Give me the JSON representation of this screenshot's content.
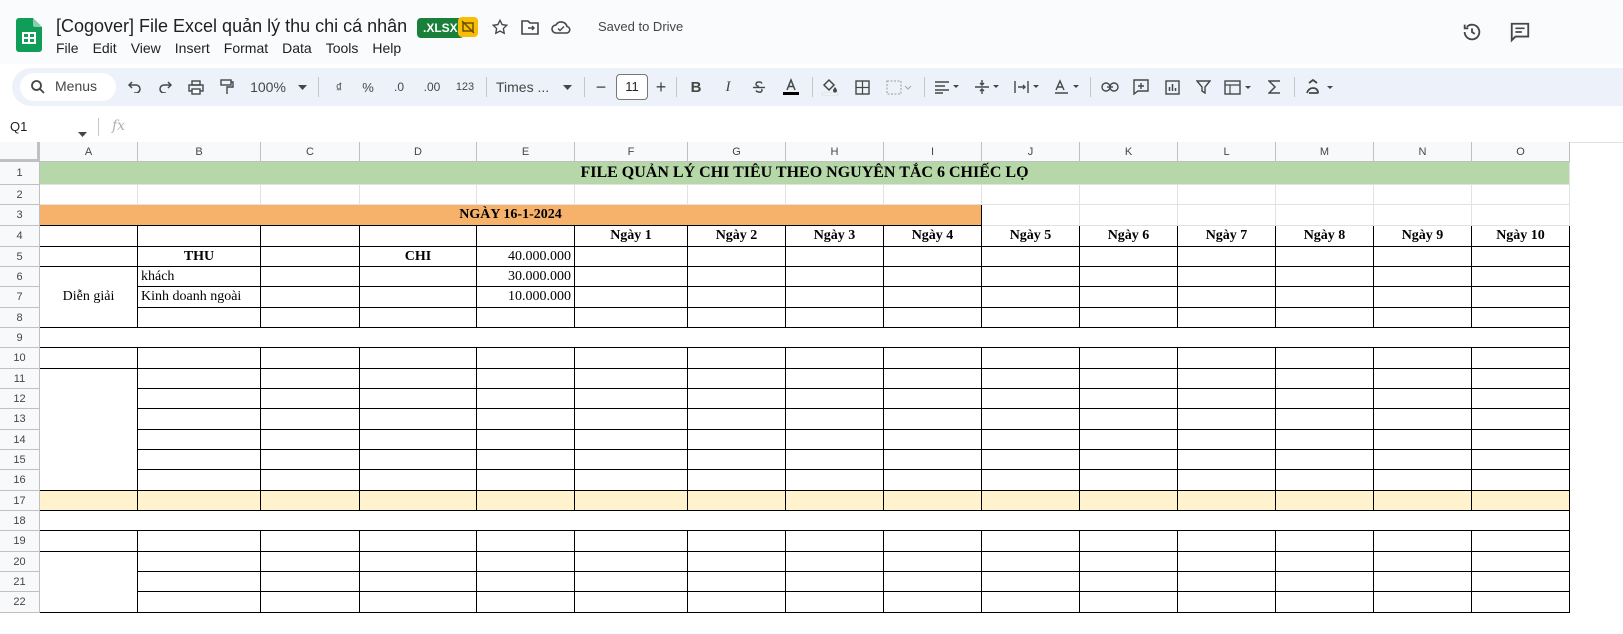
{
  "header": {
    "doc_title": "[Cogover] File Excel quản lý thu chi cá nhân",
    "file_badge": ".XLSX",
    "saved_status": "Saved to Drive",
    "icons": [
      "sheets-logo-icon",
      "no-edit-icon",
      "star-icon",
      "move-folder-icon",
      "cloud-saved-icon",
      "history-icon",
      "comment-icon"
    ]
  },
  "menu": [
    "File",
    "Edit",
    "View",
    "Insert",
    "Format",
    "Data",
    "Tools",
    "Help"
  ],
  "toolbar": {
    "search_label": "Menus",
    "zoom": "100%",
    "currency_label": "₫",
    "percent_label": "%",
    "dec_decrease_label": ".0",
    "dec_increase_label": ".00",
    "number_format_label": "123",
    "font_name": "Times ...",
    "font_size": "11",
    "minus_label": "−",
    "plus_label": "+",
    "bold_label": "B",
    "italic_label": "I"
  },
  "formula_bar": {
    "name_box": "Q1",
    "fx_label": "fx"
  },
  "sheet": {
    "columns": [
      "A",
      "B",
      "C",
      "D",
      "E",
      "F",
      "G",
      "H",
      "I",
      "J",
      "K",
      "L",
      "M",
      "N",
      "O"
    ],
    "rows": [
      "1",
      "2",
      "3",
      "4",
      "5",
      "6",
      "7",
      "8",
      "9",
      "10",
      "11",
      "12",
      "13",
      "14",
      "15",
      "16",
      "17",
      "18",
      "19",
      "20",
      "21",
      "22"
    ],
    "title": "FILE QUẢN LÝ CHI TIÊU THEO NGUYÊN TẮC 6 CHIẾC LỌ",
    "date_header": "NGÀY 16-1-2024",
    "day_headers": [
      "Ngày 1",
      "Ngày 2",
      "Ngày 3",
      "Ngày 4",
      "Ngày 5",
      "Ngày 6",
      "Ngày 7",
      "Ngày 8",
      "Ngày 9",
      "Ngày 10"
    ],
    "thu_label": "THU",
    "chi_label": "CHI",
    "dien_giai": "Diễn giải",
    "b6": "khách",
    "b7": "Kinh doanh ngoài",
    "e5": "40.000.000",
    "e6": "30.000.000",
    "e7": "10.000.000",
    "colors": {
      "title_bg": "#b6d7a8",
      "date_bg": "#f6b26b",
      "row17_bg": "#fff2cc"
    }
  }
}
